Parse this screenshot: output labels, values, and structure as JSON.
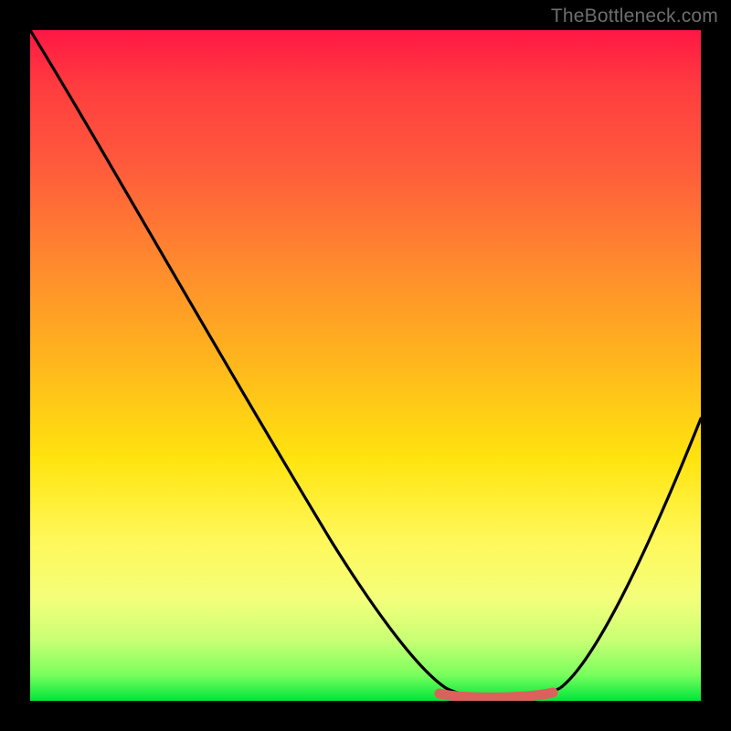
{
  "watermark": "TheBottleneck.com",
  "chart_data": {
    "type": "line",
    "title": "",
    "xlabel": "",
    "ylabel": "",
    "xlim": [
      0,
      100
    ],
    "ylim": [
      0,
      100
    ],
    "grid": false,
    "background": "rainbow-vertical",
    "note": "values estimated from curve position on unlabeled axes; 0 = bottom/left, 100 = top/right",
    "series": [
      {
        "name": "curve",
        "stroke": "#000000",
        "x": [
          0,
          5,
          10,
          15,
          20,
          25,
          30,
          35,
          40,
          45,
          50,
          55,
          60,
          62,
          66,
          70,
          74,
          78,
          80,
          82,
          86,
          90,
          94,
          100
        ],
        "values": [
          100,
          91,
          82,
          73,
          64,
          55,
          46,
          37,
          29,
          21,
          14,
          8,
          3,
          2,
          1,
          1,
          1,
          2,
          4,
          7,
          13,
          20,
          28,
          42
        ]
      },
      {
        "name": "flat-marker",
        "stroke": "#d9625d",
        "x": [
          60,
          78
        ],
        "values": [
          1,
          1
        ]
      }
    ]
  }
}
